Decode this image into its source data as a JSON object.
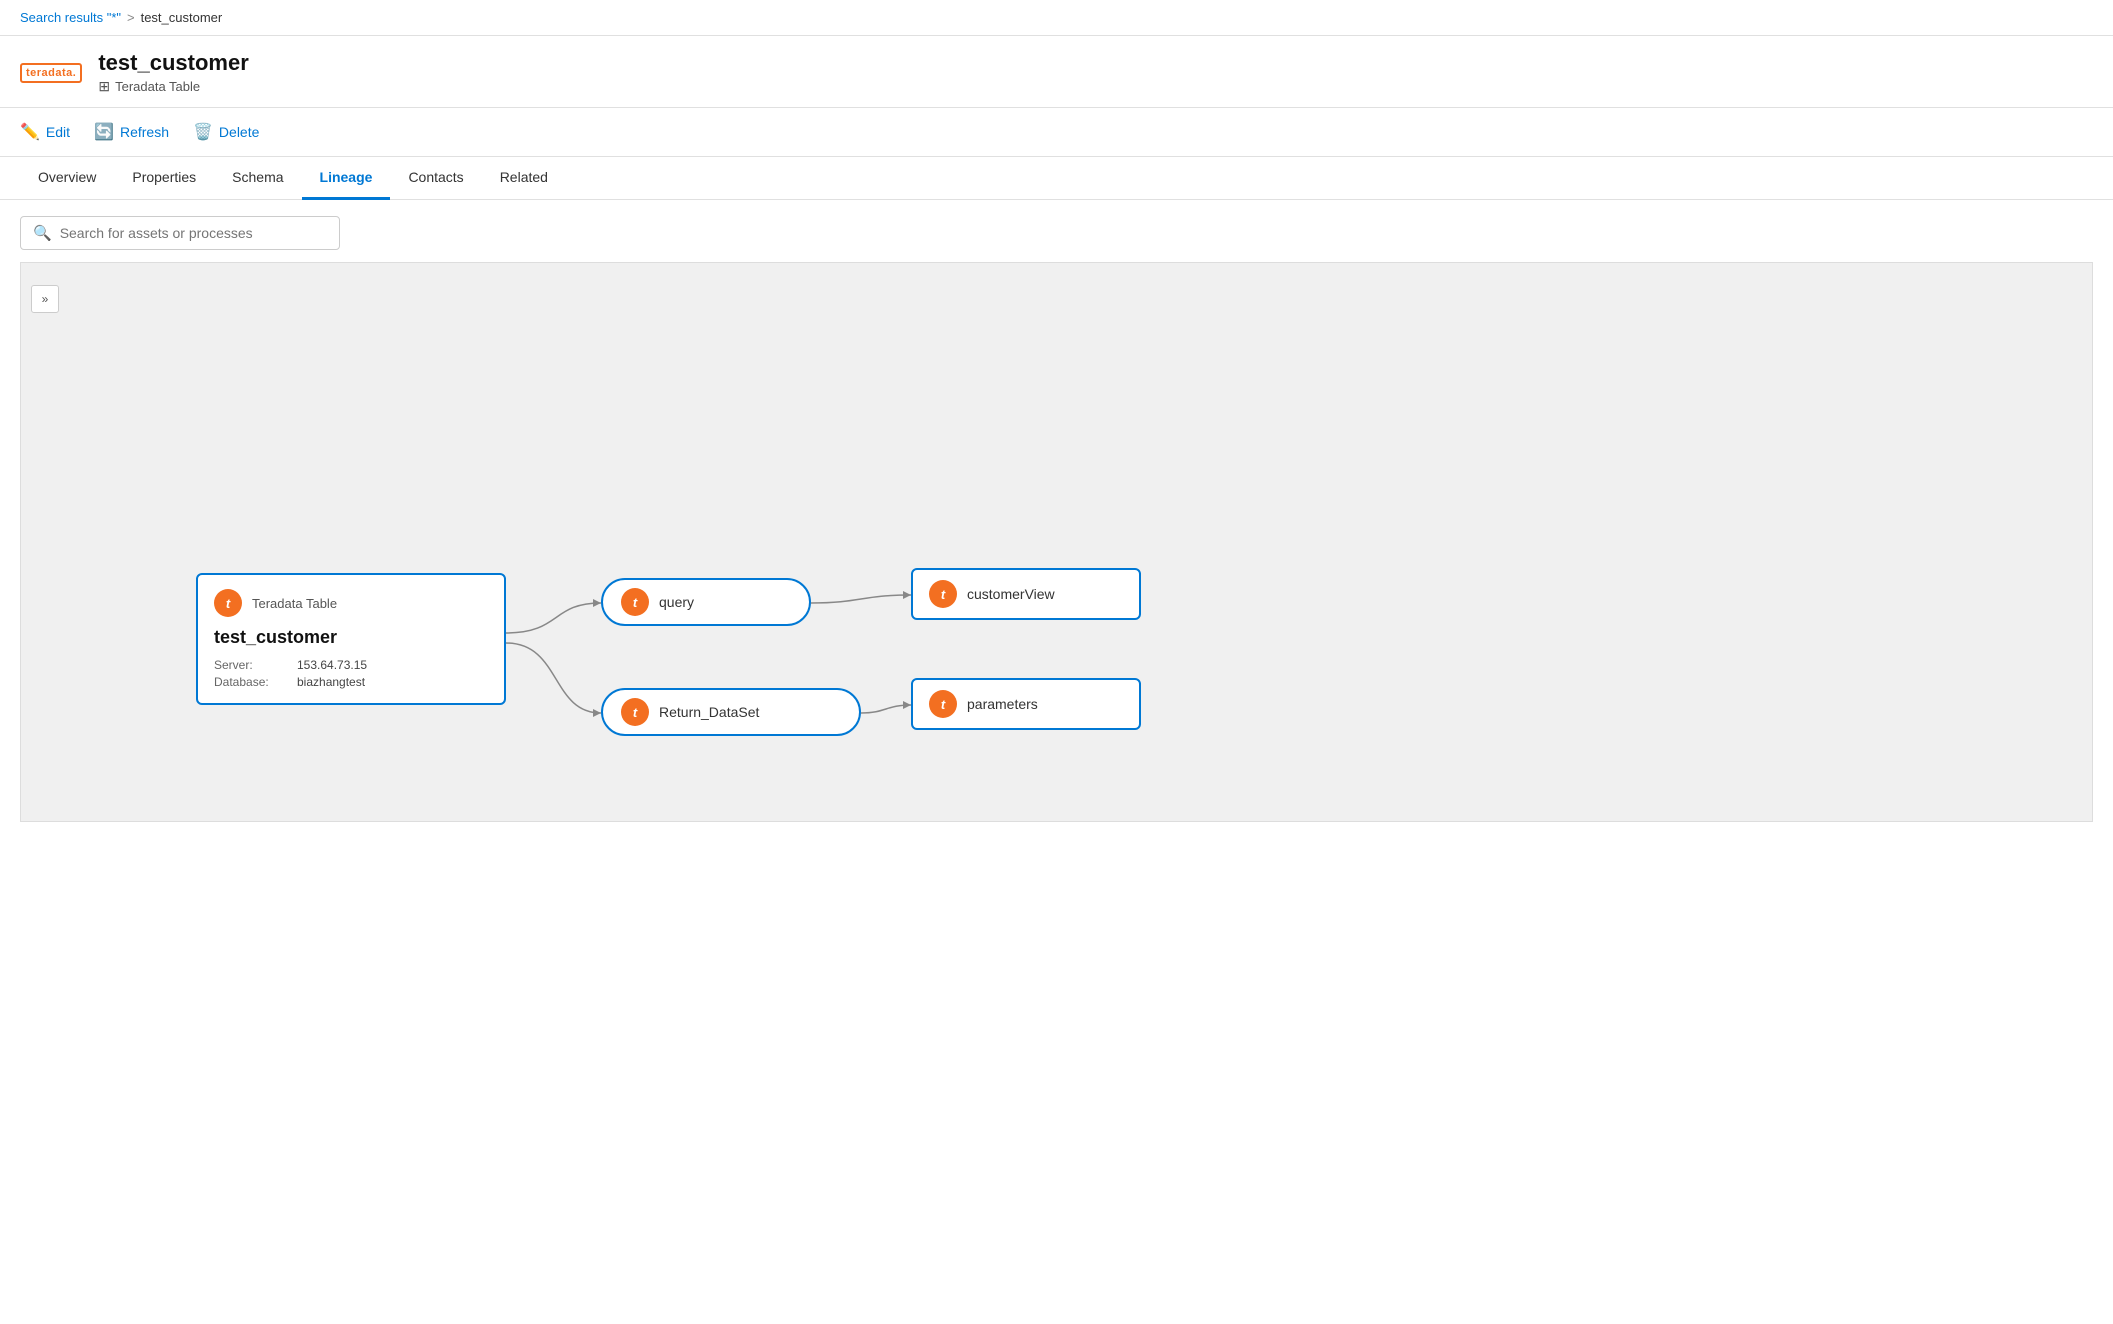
{
  "breadcrumb": {
    "search_link": "Search results \"*\"",
    "separator": ">",
    "current": "test_customer"
  },
  "asset": {
    "logo_text": "teradata.",
    "title": "test_customer",
    "type": "Teradata Table"
  },
  "toolbar": {
    "edit_label": "Edit",
    "refresh_label": "Refresh",
    "delete_label": "Delete"
  },
  "tabs": [
    {
      "label": "Overview",
      "active": false
    },
    {
      "label": "Properties",
      "active": false
    },
    {
      "label": "Schema",
      "active": false
    },
    {
      "label": "Lineage",
      "active": true
    },
    {
      "label": "Contacts",
      "active": false
    },
    {
      "label": "Related",
      "active": false
    }
  ],
  "lineage": {
    "search_placeholder": "Search for assets or processes",
    "expand_icon": "»",
    "nodes": {
      "source": {
        "type_label": "Teradata Table",
        "name": "test_customer",
        "server_label": "Server:",
        "server_value": "153.64.73.15",
        "database_label": "Database:",
        "database_value": "biazhangtest"
      },
      "query": {
        "label": "query"
      },
      "return_dataset": {
        "label": "Return_DataSet"
      },
      "customer_view": {
        "label": "customerView"
      },
      "parameters": {
        "label": "parameters"
      }
    }
  }
}
